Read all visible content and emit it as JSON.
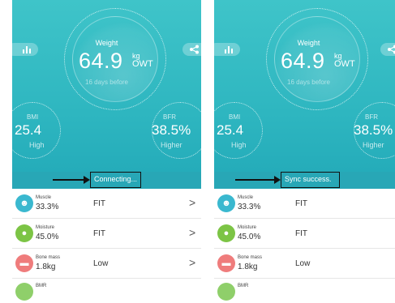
{
  "colors": {
    "hero_teal": "#2eb6c0",
    "muscle_icon": "#3ab8cf",
    "moisture_icon": "#7cc445",
    "bone_icon": "#ef7c7c",
    "bmr_icon": "#8fcf6a"
  },
  "left": {
    "weight": {
      "label": "Weight",
      "value": "64.9",
      "unit_top": "kg",
      "unit_bottom": "OWT",
      "sub": "16 days before"
    },
    "bmi": {
      "label": "BMI",
      "value": "25.4",
      "status": "High"
    },
    "bfr": {
      "label": "BFR",
      "value": "38.5%",
      "status": "Higher"
    },
    "status_text": "Connecting...",
    "metrics": [
      {
        "name": "Muscle",
        "value": "33.3%",
        "rating": "FIT",
        "icon": "muscle-icon",
        "chevron": ">"
      },
      {
        "name": "Moisture",
        "value": "45.0%",
        "rating": "FIT",
        "icon": "water-drop-icon",
        "chevron": ">"
      },
      {
        "name": "Bone mass",
        "value": "1.8kg",
        "rating": "Low",
        "icon": "bone-icon",
        "chevron": ">"
      },
      {
        "name": "BMR",
        "icon": "bmr-icon"
      }
    ]
  },
  "right": {
    "weight": {
      "label": "Weight",
      "value": "64.9",
      "unit_top": "kg",
      "unit_bottom": "OWT",
      "sub": "16 days before"
    },
    "bmi": {
      "label": "BMI",
      "value": "25.4",
      "status": "High"
    },
    "bfr": {
      "label": "BFR",
      "value": "38.5%",
      "status": "Higher"
    },
    "status_text": "Sync success.",
    "metrics": [
      {
        "name": "Muscle",
        "value": "33.3%",
        "rating": "FIT",
        "icon": "muscle-icon"
      },
      {
        "name": "Moisture",
        "value": "45.0%",
        "rating": "FIT",
        "icon": "water-drop-icon"
      },
      {
        "name": "Bone mass",
        "value": "1.8kg",
        "rating": "Low",
        "icon": "bone-icon"
      },
      {
        "name": "BMR",
        "icon": "bmr-icon"
      }
    ]
  }
}
